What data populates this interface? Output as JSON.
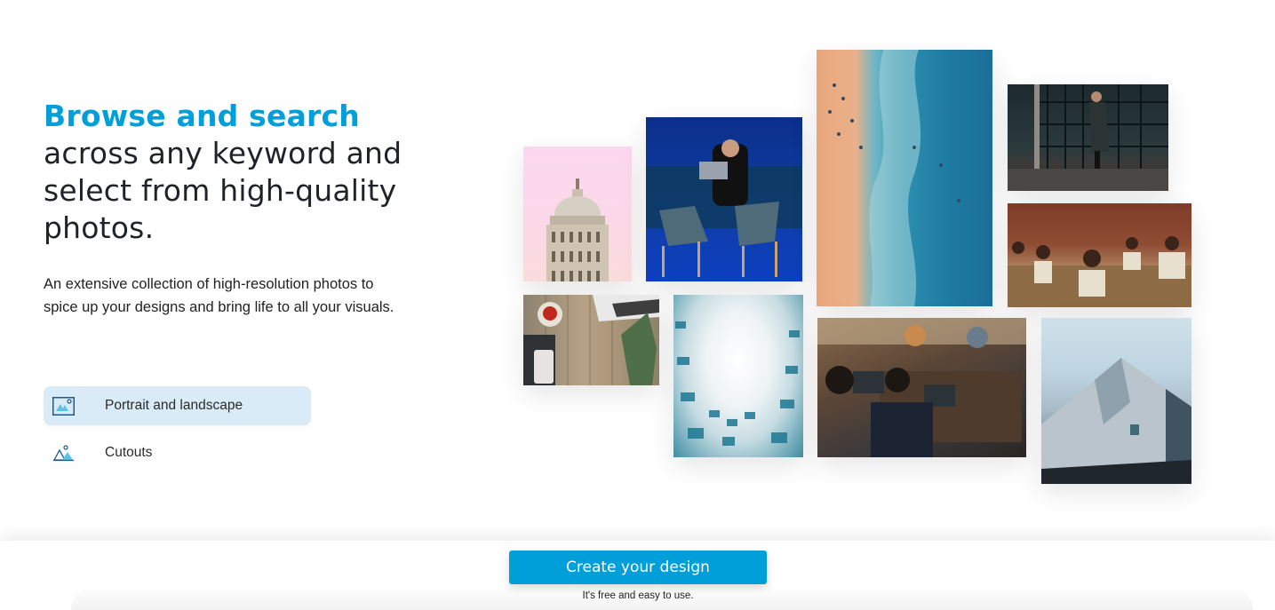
{
  "hero": {
    "headline_accent": "Browse and search",
    "headline_rest": "across any keyword and select from high-quality photos.",
    "description": "An extensive collection of high-resolution photos to spice up your designs and bring life to all your visuals."
  },
  "options": [
    {
      "label": "Portrait and landscape",
      "icon": "image-icon",
      "active": true
    },
    {
      "label": "Cutouts",
      "icon": "cutout-icon",
      "active": false
    }
  ],
  "photos": [
    {
      "subject": "dome on pink background"
    },
    {
      "subject": "man with laptop in blue room"
    },
    {
      "subject": "aerial beach and ocean"
    },
    {
      "subject": "man walking down steps"
    },
    {
      "subject": "children in classroom"
    },
    {
      "subject": "desk with pineapple and phone"
    },
    {
      "subject": "building looking up"
    },
    {
      "subject": "team working on laptops"
    },
    {
      "subject": "geometric architecture"
    }
  ],
  "cta": {
    "button_label": "Create your design",
    "subtext": "It's free and easy to use."
  },
  "colors": {
    "accent": "#009fd9",
    "active_option_bg": "#d9ebf6"
  }
}
